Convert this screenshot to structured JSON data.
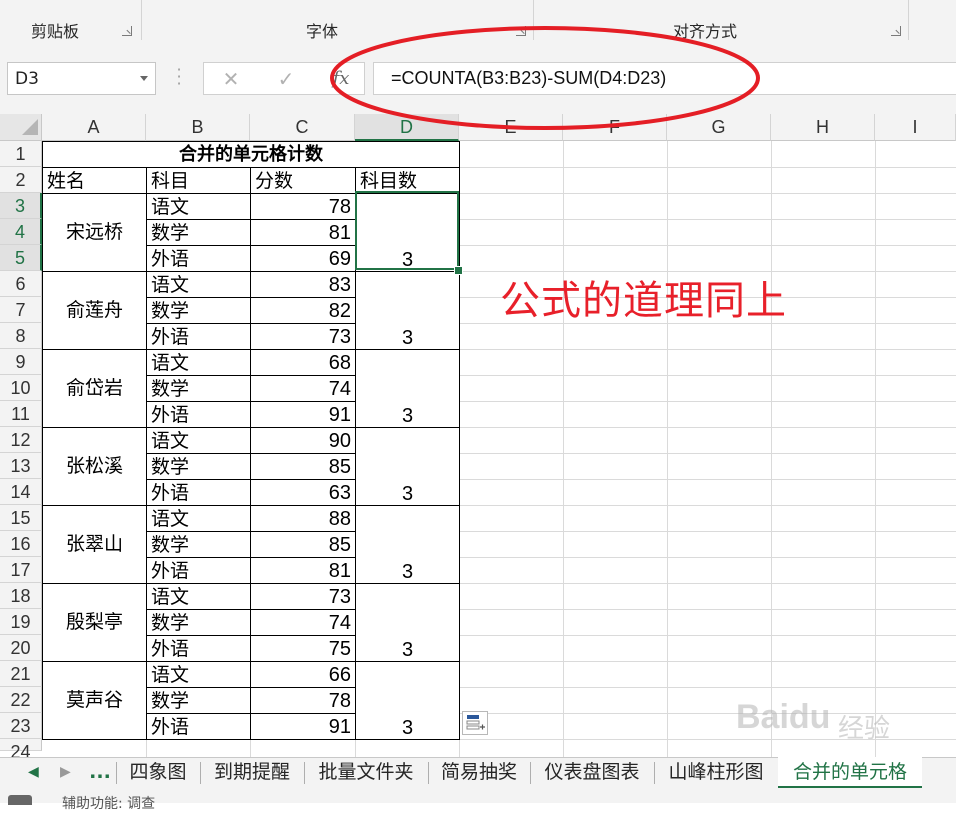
{
  "ribbon": {
    "groups": [
      "剪贴板",
      "字体",
      "对齐方式"
    ]
  },
  "formula_bar": {
    "name_box": "D3",
    "cancel_icon": "✕",
    "enter_icon": "✓",
    "fx_label": "fx",
    "formula": "=COUNTA(B3:B23)-SUM(D4:D23)"
  },
  "columns": [
    "A",
    "B",
    "C",
    "D",
    "E",
    "F",
    "G",
    "H",
    "I"
  ],
  "selected_column": "D",
  "rows": [
    "1",
    "2",
    "3",
    "4",
    "5",
    "6",
    "7",
    "8",
    "9",
    "10",
    "11",
    "12",
    "13",
    "14",
    "15",
    "16",
    "17",
    "18",
    "19",
    "20",
    "21",
    "22",
    "23",
    "24"
  ],
  "selected_rows": [
    "3",
    "4",
    "5"
  ],
  "sheet": {
    "title": "合并的单元格计数",
    "headers": [
      "姓名",
      "科目",
      "分数",
      "科目数"
    ],
    "groups": [
      {
        "name": "宋远桥",
        "subjects": [
          "语文",
          "数学",
          "外语"
        ],
        "scores": [
          "78",
          "81",
          "69"
        ],
        "count": "3"
      },
      {
        "name": "俞莲舟",
        "subjects": [
          "语文",
          "数学",
          "外语"
        ],
        "scores": [
          "83",
          "82",
          "73"
        ],
        "count": "3"
      },
      {
        "name": "俞岱岩",
        "subjects": [
          "语文",
          "数学",
          "外语"
        ],
        "scores": [
          "68",
          "74",
          "91"
        ],
        "count": "3"
      },
      {
        "name": "张松溪",
        "subjects": [
          "语文",
          "数学",
          "外语"
        ],
        "scores": [
          "90",
          "85",
          "63"
        ],
        "count": "3"
      },
      {
        "name": "张翠山",
        "subjects": [
          "语文",
          "数学",
          "外语"
        ],
        "scores": [
          "88",
          "85",
          "81"
        ],
        "count": "3"
      },
      {
        "name": "殷梨亭",
        "subjects": [
          "语文",
          "数学",
          "外语"
        ],
        "scores": [
          "73",
          "74",
          "75"
        ],
        "count": "3"
      },
      {
        "name": "莫声谷",
        "subjects": [
          "语文",
          "数学",
          "外语"
        ],
        "scores": [
          "66",
          "78",
          "91"
        ],
        "count": "3"
      }
    ]
  },
  "annotation": "公式的道理同上",
  "tabs": {
    "ellipsis": "...",
    "items": [
      "四象图",
      "到期提醒",
      "批量文件夹",
      "简易抽奖",
      "仪表盘图表",
      "山峰柱形图",
      "合并的单元格"
    ],
    "active": "合并的单元格"
  },
  "status": {
    "text": "辅助功能: 调查"
  },
  "watermark": {
    "logo": "Baidu",
    "suffix": "经验"
  },
  "colors": {
    "accent": "#217346",
    "annotation": "#e8202a"
  }
}
